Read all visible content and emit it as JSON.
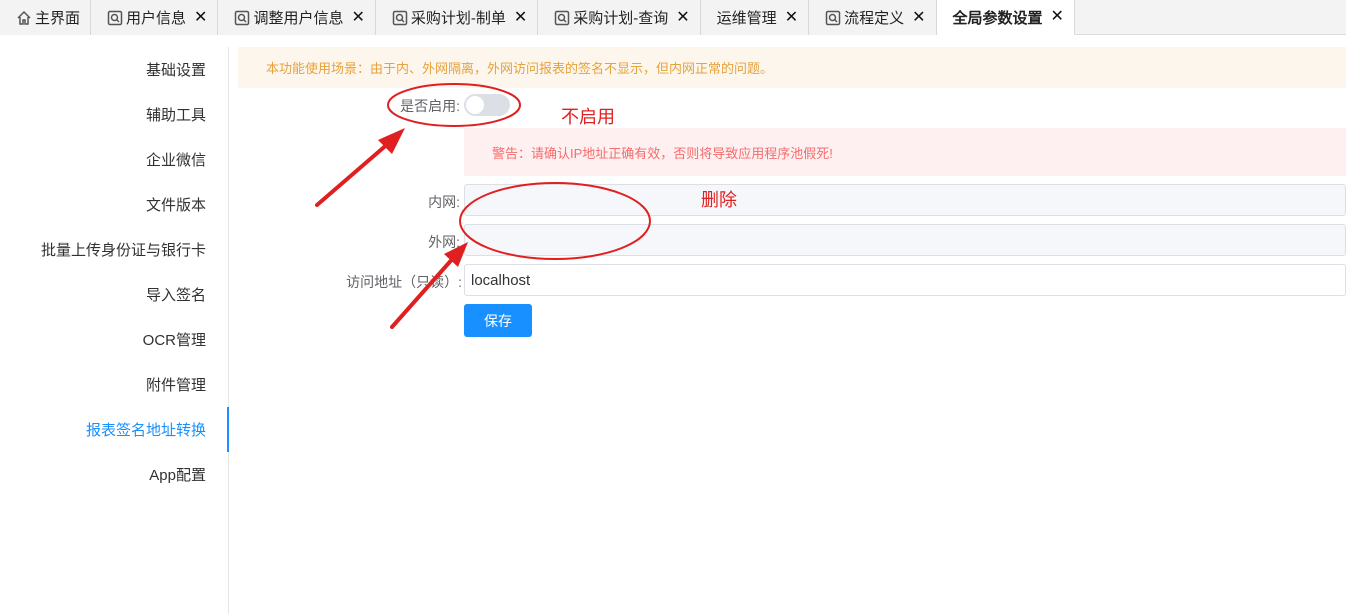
{
  "tabs": [
    {
      "label": "主界面",
      "icon": "home-icon",
      "closable": false,
      "active": false
    },
    {
      "label": "用户信息",
      "icon": "search-doc-icon",
      "closable": true,
      "active": false
    },
    {
      "label": "调整用户信息",
      "icon": "search-doc-icon",
      "closable": true,
      "active": false
    },
    {
      "label": "采购计划-制单",
      "icon": "search-doc-icon",
      "closable": true,
      "active": false
    },
    {
      "label": "采购计划-查询",
      "icon": "search-doc-icon",
      "closable": true,
      "active": false
    },
    {
      "label": "运维管理",
      "icon": "",
      "closable": true,
      "active": false
    },
    {
      "label": "流程定义",
      "icon": "search-doc-icon",
      "closable": true,
      "active": false
    },
    {
      "label": "全局参数设置",
      "icon": "",
      "closable": true,
      "active": true
    }
  ],
  "close_glyph": "✕",
  "sidebar": {
    "items": [
      {
        "label": "基础设置"
      },
      {
        "label": "辅助工具"
      },
      {
        "label": "企业微信"
      },
      {
        "label": "文件版本"
      },
      {
        "label": "批量上传身份证与银行卡"
      },
      {
        "label": "导入签名"
      },
      {
        "label": "OCR管理"
      },
      {
        "label": "附件管理"
      },
      {
        "label": "报表签名地址转换"
      },
      {
        "label": "App配置"
      }
    ],
    "active_index": 8
  },
  "main": {
    "notice": "本功能使用场景：由于内、外网隔离，外网访问报表的签名不显示，但内网正常的问题。",
    "enable_label": "是否启用:",
    "enabled": false,
    "warning": "警告：请确认IP地址正确有效，否则将导致应用程序池假死!",
    "intranet_label": "内网:",
    "intranet_value": "",
    "extranet_label": "外网:",
    "extranet_value": "",
    "access_label": "访问地址（只读）:",
    "access_value": "localhost",
    "save_label": "保存"
  },
  "annotations": {
    "disable_note": "不启用",
    "delete_note": "删除",
    "color": "#e02020"
  },
  "colors": {
    "primary": "#1890ff",
    "notice_bg": "#fdf6ec",
    "notice_text": "#e6a23c",
    "warning_bg": "#fef0f0",
    "warning_text": "#f56c6c"
  }
}
